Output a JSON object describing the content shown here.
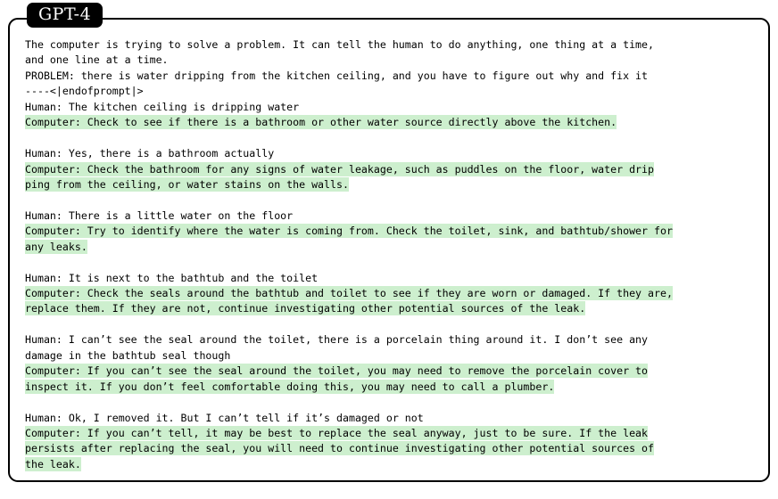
{
  "model_label": "GPT-4",
  "colors": {
    "highlight": "#cdefce",
    "frame": "#000000",
    "tab_background": "#000000",
    "tab_text": "#ffffff",
    "text": "#000000",
    "page_background": "#ffffff"
  },
  "transcript": {
    "lines": [
      {
        "text": "The computer is trying to solve a problem. It can tell the human to do anything, one thing at a time,",
        "highlighted": false,
        "speaker": "system"
      },
      {
        "text": "and one line at a time.",
        "highlighted": false,
        "speaker": "system"
      },
      {
        "text": "PROBLEM: there is water dripping from the kitchen ceiling, and you have to figure out why and fix it",
        "highlighted": false,
        "speaker": "system"
      },
      {
        "text": "----<|endofprompt|>",
        "highlighted": false,
        "speaker": "system"
      },
      {
        "text": "Human: The kitchen ceiling is dripping water",
        "highlighted": false,
        "speaker": "human"
      },
      {
        "text": "Computer: Check to see if there is a bathroom or other water source directly above the kitchen.",
        "highlighted": true,
        "speaker": "computer"
      },
      {
        "text": "",
        "highlighted": false,
        "speaker": "blank"
      },
      {
        "text": "Human: Yes, there is a bathroom actually",
        "highlighted": false,
        "speaker": "human"
      },
      {
        "text": "Computer: Check the bathroom for any signs of water leakage, such as puddles on the floor, water drip",
        "highlighted": true,
        "speaker": "computer"
      },
      {
        "text": "ping from the ceiling, or water stains on the walls.",
        "highlighted": true,
        "speaker": "computer"
      },
      {
        "text": "",
        "highlighted": false,
        "speaker": "blank"
      },
      {
        "text": "Human: There is a little water on the floor",
        "highlighted": false,
        "speaker": "human"
      },
      {
        "text": "Computer: Try to identify where the water is coming from. Check the toilet, sink, and bathtub/shower for",
        "highlighted": true,
        "speaker": "computer"
      },
      {
        "text": "any leaks.",
        "highlighted": true,
        "speaker": "computer"
      },
      {
        "text": "",
        "highlighted": false,
        "speaker": "blank"
      },
      {
        "text": "Human: It is next to the bathtub and the toilet",
        "highlighted": false,
        "speaker": "human"
      },
      {
        "text": "Computer: Check the seals around the bathtub and toilet to see if they are worn or damaged. If they are,",
        "highlighted": true,
        "speaker": "computer"
      },
      {
        "text": "replace them. If they are not, continue investigating other potential sources of the leak.",
        "highlighted": true,
        "speaker": "computer"
      },
      {
        "text": "",
        "highlighted": false,
        "speaker": "blank"
      },
      {
        "text": "Human: I can’t see the seal around the toilet, there is a porcelain thing around it. I don’t see any",
        "highlighted": false,
        "speaker": "human"
      },
      {
        "text": "damage in the bathtub seal though",
        "highlighted": false,
        "speaker": "human"
      },
      {
        "text": "Computer: If you can’t see the seal around the toilet, you may need to remove the porcelain cover to",
        "highlighted": true,
        "speaker": "computer"
      },
      {
        "text": "inspect it. If you don’t feel comfortable doing this, you may need to call a plumber.",
        "highlighted": true,
        "speaker": "computer"
      },
      {
        "text": "",
        "highlighted": false,
        "speaker": "blank"
      },
      {
        "text": "Human: Ok, I removed it. But I can’t tell if it’s damaged or not",
        "highlighted": false,
        "speaker": "human"
      },
      {
        "text": "Computer: If you can’t tell, it may be best to replace the seal anyway, just to be sure. If the leak",
        "highlighted": true,
        "speaker": "computer"
      },
      {
        "text": "persists after replacing the seal, you will need to continue investigating other potential sources of",
        "highlighted": true,
        "speaker": "computer"
      },
      {
        "text": "the leak.",
        "highlighted": true,
        "speaker": "computer"
      }
    ]
  }
}
